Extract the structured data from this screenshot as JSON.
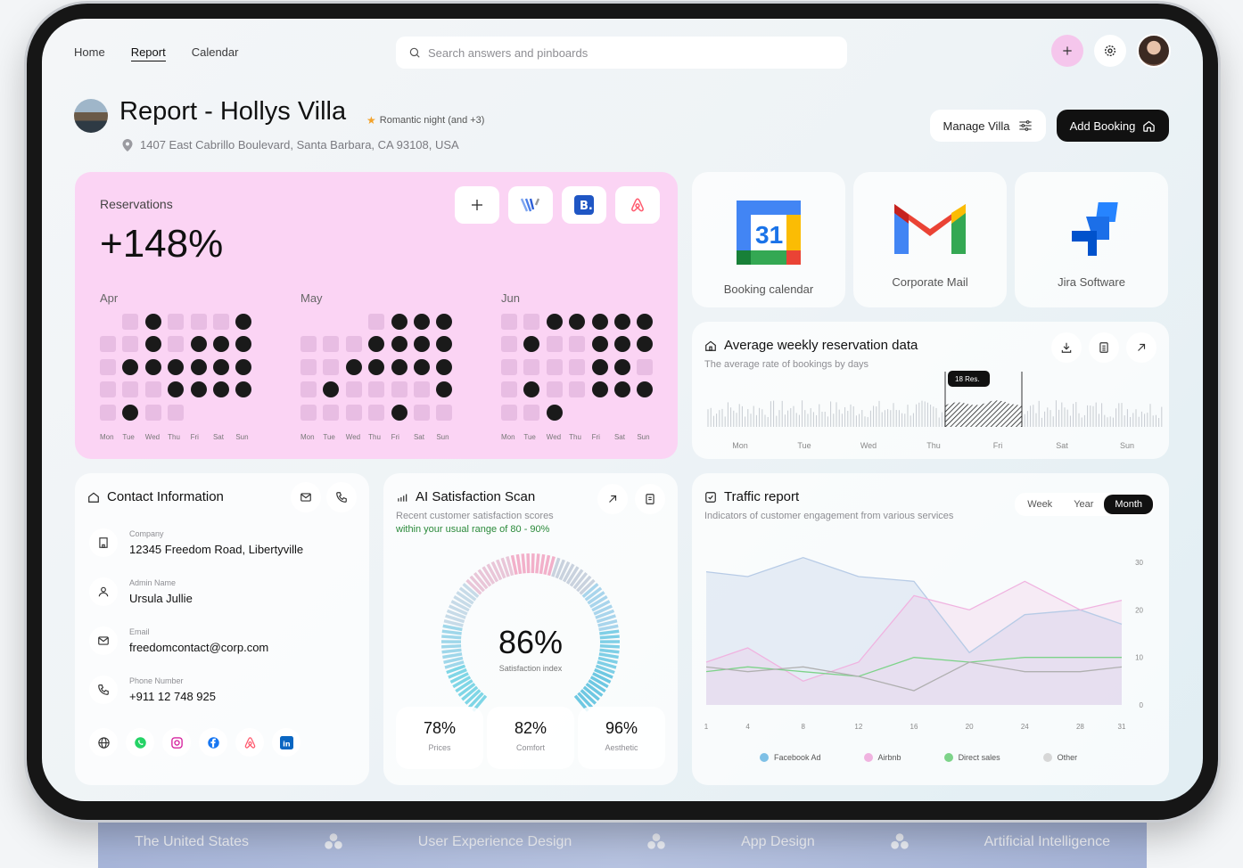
{
  "nav": {
    "items": [
      "Home",
      "Report",
      "Calendar"
    ],
    "active": "Report"
  },
  "search": {
    "placeholder": "Search answers and pinboards"
  },
  "header": {
    "title": "Report - Hollys Villa",
    "tag": "Romantic night (and +3)",
    "address": "1407 East Cabrillo Boulevard, Santa Barbara, CA 93108, USA",
    "manage_label": "Manage Villa",
    "add_label": "Add Booking"
  },
  "reservations": {
    "label": "Reservations",
    "value": "+148%",
    "days": [
      "Mon",
      "Tue",
      "Wed",
      "Thu",
      "Fri",
      "Sat",
      "Sun"
    ],
    "months": [
      {
        "name": "Apr",
        "grid": "0121112|1121222|1222222|1112222|1211000"
      },
      {
        "name": "May",
        "grid": "0001222|1112222|1122222|1211112|1111211"
      },
      {
        "name": "Jun",
        "grid": "1122222|1211222|1111221|1211222|1120000"
      }
    ]
  },
  "apps": [
    {
      "label": "Booking calendar",
      "day": "31"
    },
    {
      "label": "Corporate Mail"
    },
    {
      "label": "Jira Software"
    }
  ],
  "weekly": {
    "title": "Average weekly reservation data",
    "subtitle": "The average rate of bookings by days",
    "badge": "18 Res.",
    "days": [
      "Mon",
      "Tue",
      "Wed",
      "Thu",
      "Fri",
      "Sat",
      "Sun"
    ]
  },
  "contact": {
    "title": "Contact Information",
    "rows": [
      {
        "label": "Company",
        "value": "12345 Freedom Road, Libertyville"
      },
      {
        "label": "Admin Name",
        "value": "Ursula Jullie"
      },
      {
        "label": "Email",
        "value": "freedomcontact@corp.com"
      },
      {
        "label": "Phone Number",
        "value": "+911 12 748 925"
      }
    ]
  },
  "ai": {
    "title": "AI Satisfaction Scan",
    "subtitle": "Recent customer satisfaction scores",
    "range": "within your usual range of 80 - 90%",
    "value": "86%",
    "value_num": 86,
    "value_label": "Satisfaction index",
    "stats": [
      {
        "value": "78%",
        "label": "Prices"
      },
      {
        "value": "82%",
        "label": "Comfort"
      },
      {
        "value": "96%",
        "label": "Aesthetic"
      }
    ]
  },
  "traffic": {
    "title": "Traffic report",
    "subtitle": "Indicators of customer engagement from various services",
    "tabs": [
      "Week",
      "Year",
      "Month"
    ],
    "active_tab": "Month"
  },
  "chart_data": {
    "type": "line",
    "x": [
      1,
      4,
      8,
      12,
      16,
      20,
      24,
      28,
      31
    ],
    "ylim": [
      0,
      30
    ],
    "yticks": [
      0,
      10,
      20,
      30
    ],
    "series": [
      {
        "name": "Facebook Ad",
        "color": "#b7cbe6",
        "values": [
          28,
          27,
          31,
          27,
          26,
          11,
          19,
          20,
          17
        ]
      },
      {
        "name": "Airbnb",
        "color": "#f0b3e0",
        "values": [
          9,
          12,
          5,
          9,
          23,
          20,
          26,
          20,
          22
        ]
      },
      {
        "name": "Direct sales",
        "color": "#7dd389",
        "values": [
          7,
          8,
          7,
          6,
          10,
          9,
          10,
          10,
          10
        ]
      },
      {
        "name": "Other",
        "color": "#b0b0b0",
        "values": [
          8,
          7,
          8,
          6,
          3,
          9,
          7,
          7,
          8
        ]
      }
    ]
  },
  "band": [
    "The United States",
    "User Experience Design",
    "App Design",
    "Artificial Intelligence"
  ],
  "colors": {
    "accent_pink": "#fbd4f4",
    "dark": "#111111",
    "green": "#2a8a3a"
  }
}
